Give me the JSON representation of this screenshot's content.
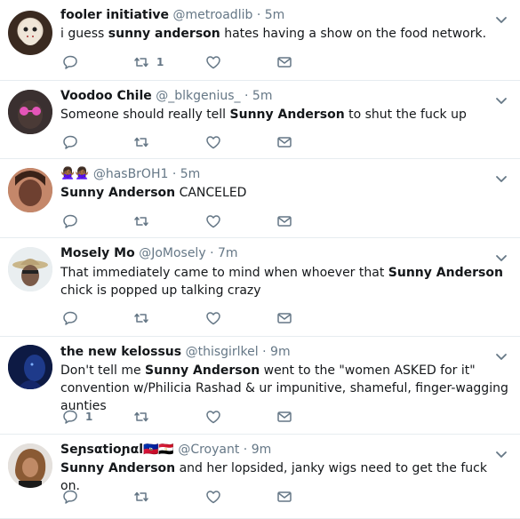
{
  "tweets": [
    {
      "name": "fooler initiative",
      "handle": "@metroadlib",
      "dot": "·",
      "time": "5m",
      "text": [
        {
          "t": "i guess "
        },
        {
          "t": "sunny anderson",
          "b": true
        },
        {
          "t": " hates having a show on the food network."
        }
      ],
      "replies": "",
      "retweets": "1",
      "likes": ""
    },
    {
      "name": "Voodoo Chile",
      "handle": "@_blkgenius_",
      "dot": "·",
      "time": "5m",
      "text": [
        {
          "t": "Someone should really tell "
        },
        {
          "t": "Sunny Anderson",
          "b": true
        },
        {
          "t": " to shut the fuck up"
        }
      ],
      "replies": "",
      "retweets": "",
      "likes": ""
    },
    {
      "name": "🙅🏾‍♀️🙅🏾‍♀️",
      "handle": "@hasBrOH1",
      "dot": "·",
      "time": "5m",
      "text": [
        {
          "t": "Sunny Anderson",
          "b": true
        },
        {
          "t": " CANCELED"
        }
      ],
      "replies": "",
      "retweets": "",
      "likes": ""
    },
    {
      "name": "Mosely Mo",
      "handle": "@JoMosely",
      "dot": "·",
      "time": "7m",
      "text": [
        {
          "t": "That immediately came to mind when whoever that "
        },
        {
          "t": "Sunny Anderson",
          "b": true
        },
        {
          "t": " chick is popped up talking crazy"
        }
      ],
      "replies": "",
      "retweets": "",
      "likes": ""
    },
    {
      "name": "the new kelossus",
      "handle": "@thisgirlkel",
      "dot": "·",
      "time": "9m",
      "text": [
        {
          "t": "Don't tell me "
        },
        {
          "t": "Sunny Anderson",
          "b": true
        },
        {
          "t": " went to the \"women ASKED for it\" convention w/Philicia Rashad & ur impunitive, shameful, finger-wagging aunties"
        }
      ],
      "replies": "1",
      "retweets": "",
      "likes": ""
    },
    {
      "name": "Seɲsαtioɲαl🇭🇹🇪🇬",
      "handle": "@Croyant",
      "dot": "·",
      "time": "9m",
      "text": [
        {
          "t": "Sunny Anderson",
          "b": true
        },
        {
          "t": " and her lopsided, janky wigs need to get the fuck on."
        }
      ],
      "replies": "",
      "retweets": "",
      "likes": ""
    }
  ],
  "colors": {
    "text": "#14171a",
    "muted": "#657786",
    "divider": "#e6ecf0"
  },
  "icons": [
    "reply-icon",
    "retweet-icon",
    "like-icon",
    "direct-message-icon",
    "chevron-down-icon"
  ]
}
